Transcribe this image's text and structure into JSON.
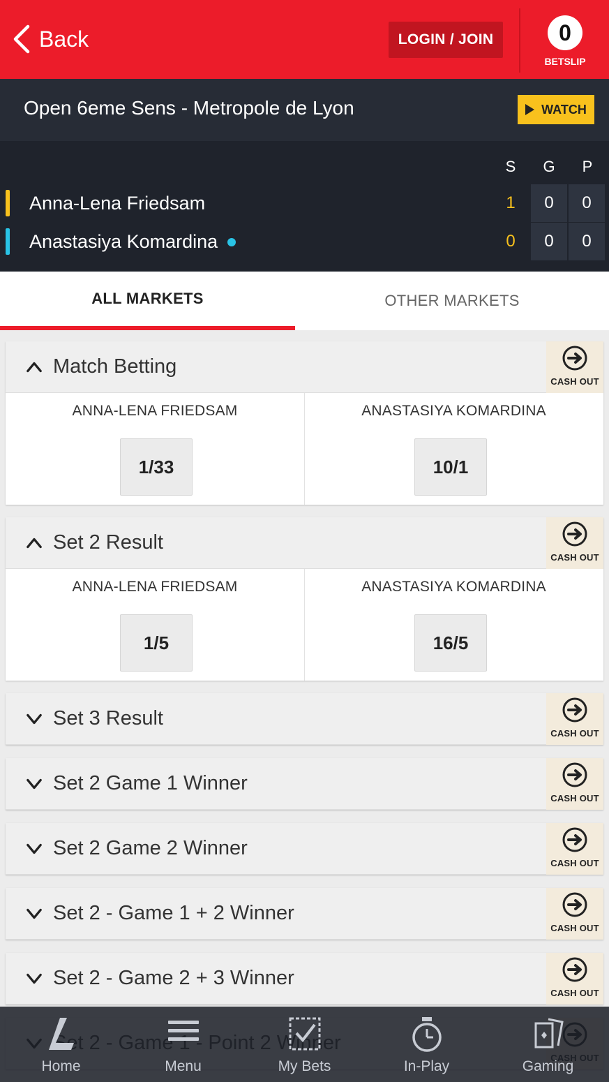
{
  "header": {
    "back_label": "Back",
    "login_label": "LOGIN / JOIN",
    "betslip_count": "0",
    "betslip_label": "BETSLIP"
  },
  "event": {
    "title": "Open 6eme Sens - Metropole de Lyon",
    "watch_label": "WATCH"
  },
  "scoreboard": {
    "columns": [
      "S",
      "G",
      "P"
    ],
    "players": [
      {
        "name": "Anna-Lena Friedsam",
        "color": "#f8c11d",
        "serving": false,
        "sets": "1",
        "games": "0",
        "points": "0"
      },
      {
        "name": "Anastasiya Komardina",
        "color": "#29c3e6",
        "serving": true,
        "sets": "0",
        "games": "0",
        "points": "0"
      }
    ]
  },
  "tabs": {
    "all_markets": "ALL MARKETS",
    "other_markets": "OTHER MARKETS"
  },
  "markets": [
    {
      "title": "Match Betting",
      "expanded": true,
      "cashout": "CASH OUT",
      "selections": [
        {
          "name": "ANNA-LENA FRIEDSAM",
          "odds": "1/33"
        },
        {
          "name": "ANASTASIYA KOMARDINA",
          "odds": "10/1"
        }
      ]
    },
    {
      "title": "Set 2 Result",
      "expanded": true,
      "cashout": "CASH OUT",
      "selections": [
        {
          "name": "ANNA-LENA FRIEDSAM",
          "odds": "1/5"
        },
        {
          "name": "ANASTASIYA KOMARDINA",
          "odds": "16/5"
        }
      ]
    },
    {
      "title": "Set 3 Result",
      "expanded": false,
      "cashout": "CASH OUT"
    },
    {
      "title": "Set 2 Game 1 Winner",
      "expanded": false,
      "cashout": "CASH OUT"
    },
    {
      "title": "Set 2 Game 2 Winner",
      "expanded": false,
      "cashout": "CASH OUT"
    },
    {
      "title": "Set 2 - Game 1 + 2 Winner",
      "expanded": false,
      "cashout": "CASH OUT"
    },
    {
      "title": "Set 2 - Game 2 + 3 Winner",
      "expanded": false,
      "cashout": "CASH OUT"
    },
    {
      "title": "Set 2 - Game 1 - Point 2 Winner",
      "expanded": false,
      "cashout": "CASH OUT"
    }
  ],
  "bottom_nav": [
    {
      "label": "Home",
      "icon": "home-logo-icon"
    },
    {
      "label": "Menu",
      "icon": "menu-icon"
    },
    {
      "label": "My Bets",
      "icon": "my-bets-icon"
    },
    {
      "label": "In-Play",
      "icon": "stopwatch-icon"
    },
    {
      "label": "Gaming",
      "icon": "cards-icon"
    }
  ],
  "colors": {
    "brand_red": "#ec1c2a",
    "dark_bg": "#272c36",
    "watch_yellow": "#f8c11d",
    "player1": "#f8c11d",
    "player2": "#29c3e6"
  }
}
